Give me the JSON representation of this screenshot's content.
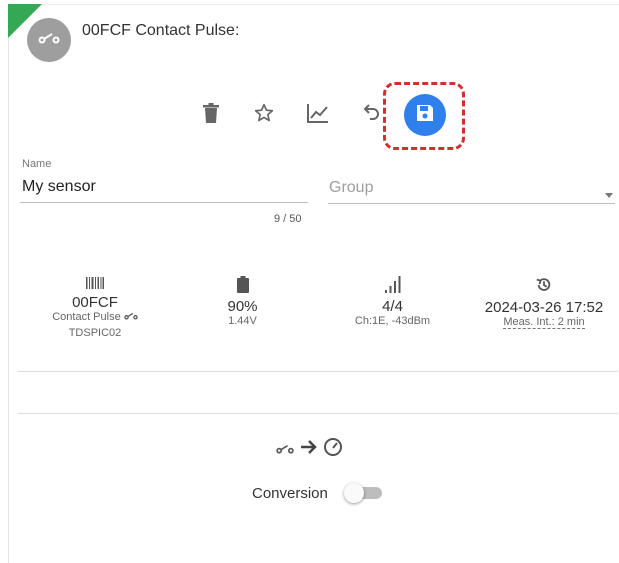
{
  "header": {
    "title": "00FCF Contact Pulse:"
  },
  "toolbar": {
    "delete_icon": "trash-icon",
    "favorite_icon": "star-icon",
    "chart_icon": "line-chart-icon",
    "undo_icon": "undo-icon",
    "save_icon": "floppy-disk-icon",
    "save_color": "#2f80ed",
    "highlight_color": "#d32f2f"
  },
  "form": {
    "name_label": "Name",
    "name_value": "My sensor",
    "name_counter": "9 / 50",
    "group_placeholder": "Group"
  },
  "stats": {
    "id": {
      "value": "00FCF",
      "type": "Contact Pulse",
      "model": "TDSPIC02",
      "icon": "barcode-icon"
    },
    "battery": {
      "percent": "90%",
      "voltage": "1.44V",
      "icon": "battery-icon"
    },
    "signal": {
      "bars": "4/4",
      "detail": "Ch:1E, -43dBm",
      "icon": "signal-icon"
    },
    "time": {
      "timestamp": "2024-03-26 17:52",
      "interval": "Meas. Int.: 2 min",
      "icon": "history-icon"
    }
  },
  "conversion": {
    "label": "Conversion",
    "enabled": false
  }
}
